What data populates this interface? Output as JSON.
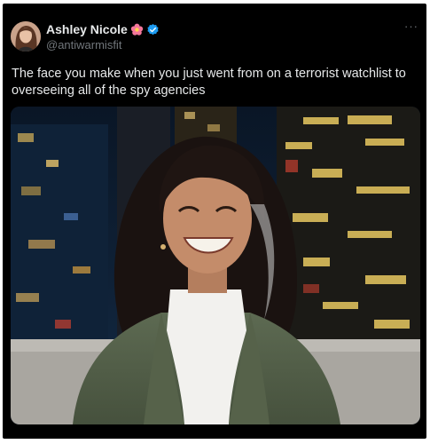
{
  "tweet": {
    "author_name": "Ashley Nicole",
    "handle": "@antiwarmisfit",
    "text": "The face you make when you just went from on a terrorist watchlist to overseeing all of the spy agencies",
    "more_label": "···"
  },
  "icons": {
    "flower": "flower-emoji-icon",
    "verified": "verified-badge-icon",
    "more": "more-options-icon"
  },
  "colors": {
    "background": "#000000",
    "text_primary": "#e7e9ea",
    "text_secondary": "#71767b",
    "verified_blue": "#1d9bf0",
    "flower_pink": "#f4769a"
  }
}
